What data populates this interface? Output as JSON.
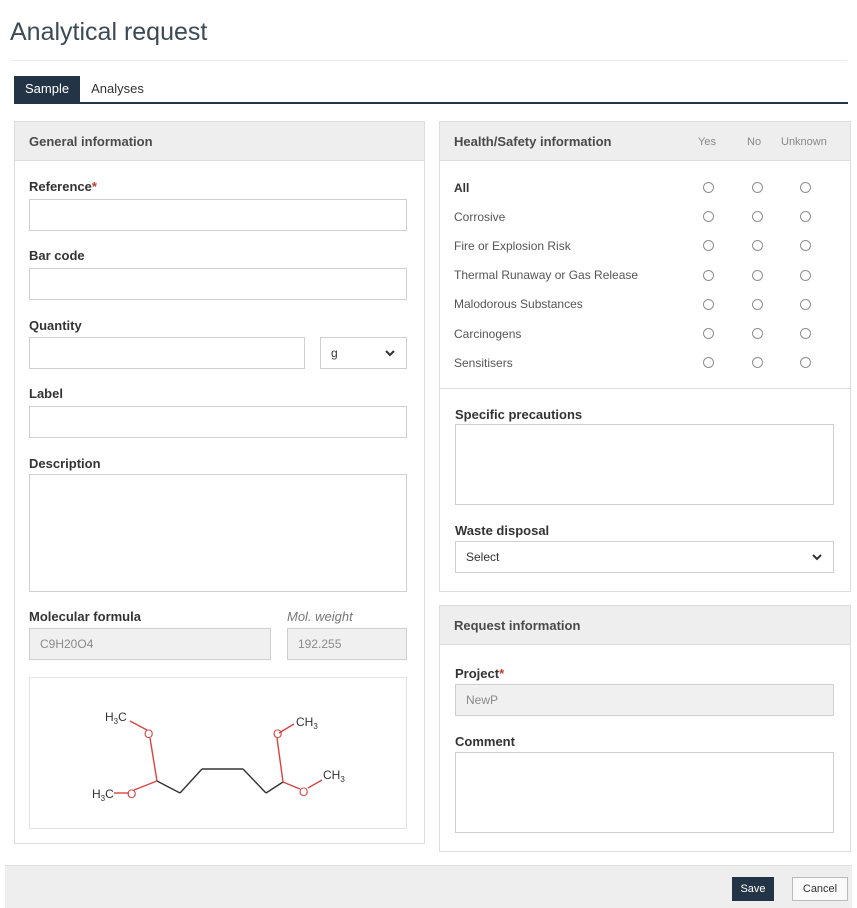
{
  "page": {
    "title": "Analytical request"
  },
  "tabs": [
    {
      "label": "Sample",
      "active": true
    },
    {
      "label": "Analyses",
      "active": false
    }
  ],
  "general": {
    "header": "General information",
    "reference": {
      "label": "Reference",
      "required_mark": "*",
      "value": ""
    },
    "barcode": {
      "label": "Bar code",
      "value": ""
    },
    "quantity": {
      "label": "Quantity",
      "value": "",
      "unit": "g"
    },
    "label_field": {
      "label": "Label",
      "value": ""
    },
    "description": {
      "label": "Description",
      "value": ""
    },
    "mol_formula": {
      "label": "Molecular formula",
      "value": "C9H20O4"
    },
    "mol_weight": {
      "label": "Mol. weight",
      "value": "192.255"
    },
    "structure": {
      "labels": {
        "h3c_top": "H3C",
        "h3c_bottom": "H3C",
        "ch3_top": "CH3",
        "ch3_bottom": "CH3",
        "o": "O"
      },
      "bond_color": "#333333",
      "oxygen_color": "#d64541"
    }
  },
  "health": {
    "header": "Health/Safety information",
    "columns": [
      "Yes",
      "No",
      "Unknown"
    ],
    "rows": [
      {
        "name": "All"
      },
      {
        "name": "Corrosive"
      },
      {
        "name": "Fire or Explosion Risk"
      },
      {
        "name": "Thermal Runaway or Gas Release"
      },
      {
        "name": "Malodorous Substances"
      },
      {
        "name": "Carcinogens"
      },
      {
        "name": "Sensitisers"
      }
    ],
    "precautions": {
      "label": "Specific precautions",
      "value": ""
    },
    "waste": {
      "label": "Waste disposal",
      "value": "Select"
    }
  },
  "request": {
    "header": "Request information",
    "project": {
      "label": "Project",
      "required_mark": "*",
      "value": "NewP"
    },
    "comment": {
      "label": "Comment",
      "value": ""
    }
  },
  "footer": {
    "save": "Save",
    "cancel": "Cancel"
  },
  "colors": {
    "accent": "#243447",
    "required": "#c0392b",
    "panel_header": "#eeeeee"
  }
}
